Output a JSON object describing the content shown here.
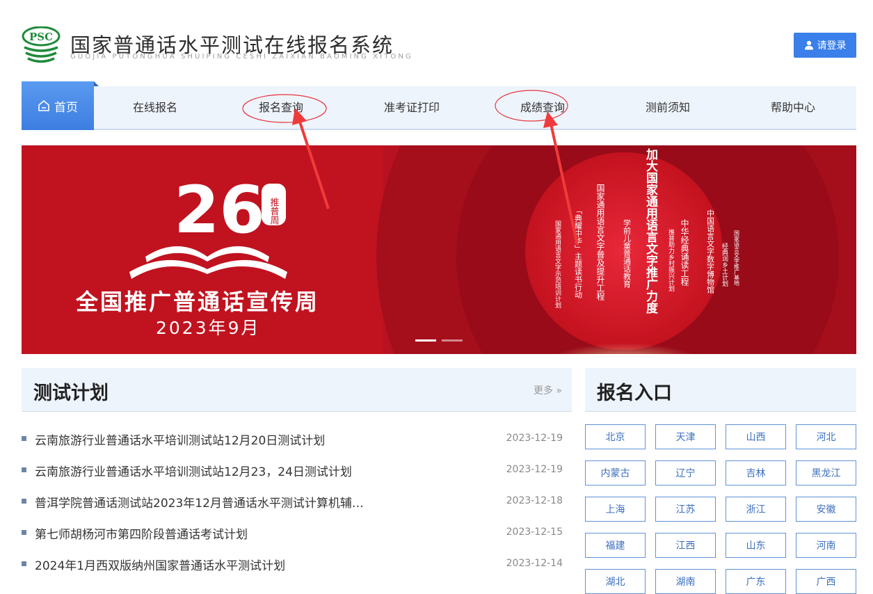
{
  "header": {
    "logo_text": "PSC",
    "title": "国家普通话水平测试在线报名系统",
    "subtitle": "GUOJIA PUTONGHUA SHUIPING CESHI ZAIXIAN BAOMING XITONG",
    "login_label": "请登录"
  },
  "nav": {
    "home": "首页",
    "items": [
      "在线报名",
      "报名查询",
      "准考证打印",
      "成绩查询",
      "测前须知",
      "帮助中心"
    ]
  },
  "banner": {
    "number": "26",
    "seal": "推普周",
    "headline": "全国推广普通话宣传周",
    "date": "2023年9月",
    "center_text": "加大国家通用语言文字推广力度",
    "columns": [
      "国家通用语言文字示范培训计划",
      "「典耀中华」主题读书行动",
      "国家通用语言文字普及提升工程",
      "学前儿童普通话教育",
      "推普助力乡村振兴计划",
      "中华经典诵读工程",
      "中国语言文字数字博物馆",
      "经典润乡土计划",
      "国家语言文字推广基地"
    ],
    "slides": 2,
    "active_slide": 1
  },
  "test_plan": {
    "title": "测试计划",
    "more": "更多 »",
    "items": [
      {
        "title": "云南旅游行业普通话水平培训测试站12月20日测试计划",
        "date": "2023-12-19"
      },
      {
        "title": "云南旅游行业普通话水平培训测试站12月23，24日测试计划",
        "date": "2023-12-19"
      },
      {
        "title": "普洱学院普通话测试站2023年12月普通话水平测试计算机辅…",
        "date": "2023-12-18"
      },
      {
        "title": "第七师胡杨河市第四阶段普通话考试计划",
        "date": "2023-12-15"
      },
      {
        "title": "2024年1月西双版纳州国家普通话水平测试计划",
        "date": "2023-12-14"
      }
    ]
  },
  "registration": {
    "title": "报名入口",
    "provinces": [
      "北京",
      "天津",
      "山西",
      "河北",
      "内蒙古",
      "辽宁",
      "吉林",
      "黑龙江",
      "上海",
      "江苏",
      "浙江",
      "安徽",
      "福建",
      "江西",
      "山东",
      "河南",
      "湖北",
      "湖南",
      "广东",
      "广西"
    ]
  },
  "colors": {
    "accent": "#3a7fea",
    "banner_red": "#b01020",
    "annotation": "#e8333a"
  }
}
